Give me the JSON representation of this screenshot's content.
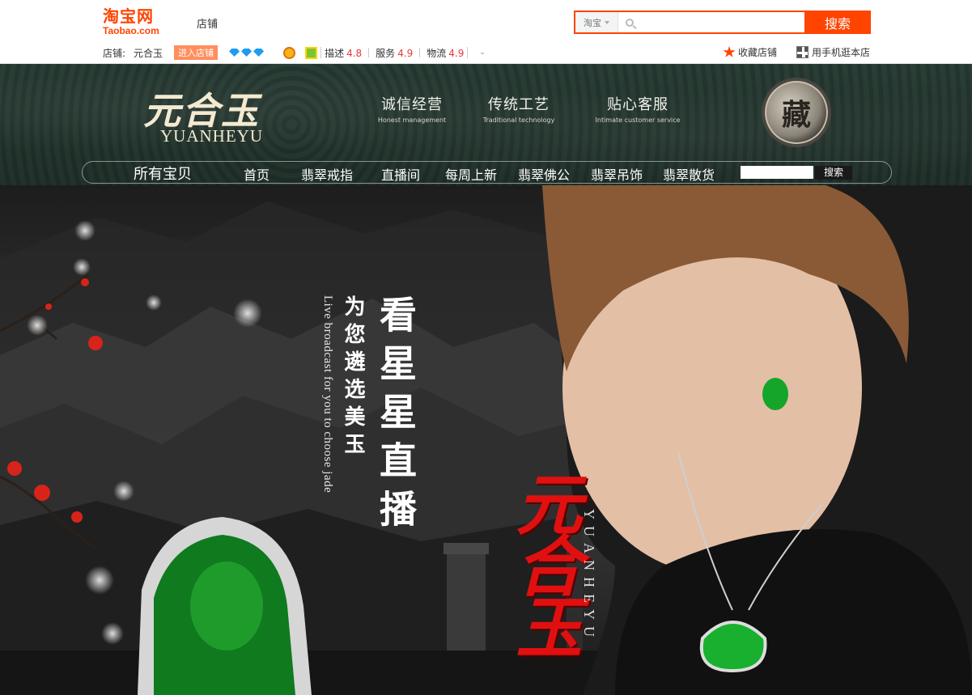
{
  "topbar": {
    "logo_cn": "淘宝网",
    "logo_en": "Taobao.com",
    "shop_label": "店铺",
    "search": {
      "scope": "淘宝",
      "placeholder": "",
      "button": "搜索"
    },
    "shop": {
      "label": "店铺:",
      "name": "元合玉",
      "enter_button": "进入店铺"
    },
    "scores": [
      {
        "label": "描述",
        "value": "4.8"
      },
      {
        "label": "服务",
        "value": "4.9"
      },
      {
        "label": "物流",
        "value": "4.9"
      }
    ],
    "favorite": "收藏店铺",
    "mobile": "用手机逛本店",
    "colors": {
      "accent": "#ff4400",
      "score": "#e4393c"
    }
  },
  "header": {
    "brand_cn": "元合玉",
    "brand_en": "YUANHEYU",
    "slogans": [
      {
        "cn": "诚信经营",
        "en": "Honest management"
      },
      {
        "cn": "传统工艺",
        "en": "Traditional technology"
      },
      {
        "cn": "贴心客服",
        "en": "Intimate customer service"
      }
    ],
    "seal_char": "藏",
    "nav": {
      "all": "所有宝贝",
      "items": [
        "首页",
        "翡翠戒指",
        "直播间",
        "每周上新",
        "翡翠佛公",
        "翡翠吊饰",
        "翡翠散货"
      ],
      "search_button": "搜索"
    }
  },
  "banner": {
    "en_line": "Live broadcast for you to choose jade",
    "cn_small": "为您遴选美玉",
    "cn_big": "看星星直播",
    "brand_red": "元合玉",
    "brand_en": "YUANHEYU"
  }
}
